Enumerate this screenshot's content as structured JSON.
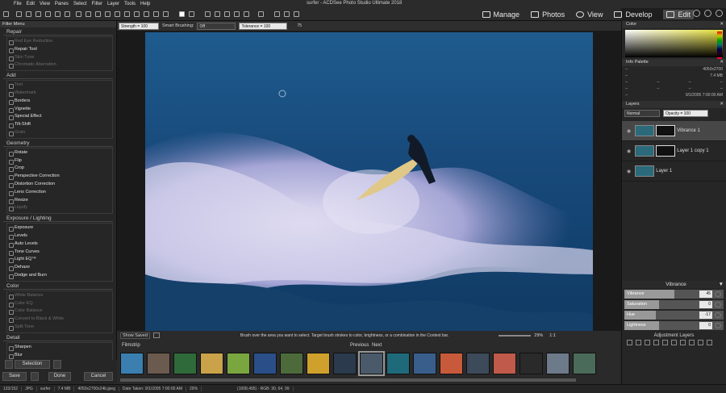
{
  "window": {
    "title": "surfer - ACDSee Photo Studio Ultimate 2018"
  },
  "menu": [
    "File",
    "Edit",
    "View",
    "Panes",
    "Select",
    "Filter",
    "Layer",
    "Tools",
    "Help"
  ],
  "modes": [
    {
      "label": "Manage"
    },
    {
      "label": "Photos"
    },
    {
      "label": "View"
    },
    {
      "label": "Develop"
    },
    {
      "label": "Edit"
    }
  ],
  "context_bar": {
    "strength": "Strength = 100",
    "smart_brushing_label": "Smart Brushing:",
    "smart_brushing_value": "Off",
    "tolerance": "Tolerance = 100",
    "brush_size": "75"
  },
  "filter_menu": {
    "title": "Filter Menu",
    "sections": [
      {
        "name": "Repair",
        "items": [
          {
            "label": "Red Eye Reduction",
            "dim": true
          },
          {
            "label": "Repair Tool",
            "dim": false
          },
          {
            "label": "Skin Tune",
            "dim": true
          },
          {
            "label": "Chromatic Aberration",
            "dim": true
          }
        ]
      },
      {
        "name": "Add",
        "items": [
          {
            "label": "Text",
            "dim": true
          },
          {
            "label": "Watermark",
            "dim": true
          },
          {
            "label": "Borders",
            "dim": false
          },
          {
            "label": "Vignette",
            "dim": false
          },
          {
            "label": "Special Effect",
            "dim": false
          },
          {
            "label": "Tilt-Shift",
            "dim": false
          },
          {
            "label": "Grain",
            "dim": true
          }
        ]
      },
      {
        "name": "Geometry",
        "items": [
          {
            "label": "Rotate",
            "dim": false
          },
          {
            "label": "Flip",
            "dim": false
          },
          {
            "label": "Crop",
            "dim": false
          },
          {
            "label": "Perspective Correction",
            "dim": false
          },
          {
            "label": "Distortion Correction",
            "dim": false
          },
          {
            "label": "Lens Correction",
            "dim": false
          },
          {
            "label": "Resize",
            "dim": false
          },
          {
            "label": "Liquify",
            "dim": true
          }
        ]
      },
      {
        "name": "Exposure / Lighting",
        "items": [
          {
            "label": "Exposure",
            "dim": false
          },
          {
            "label": "Levels",
            "dim": false
          },
          {
            "label": "Auto Levels",
            "dim": false
          },
          {
            "label": "Tone Curves",
            "dim": false
          },
          {
            "label": "Light EQ™",
            "dim": false
          },
          {
            "label": "Dehaze",
            "dim": false
          },
          {
            "label": "Dodge and Burn",
            "dim": false
          }
        ]
      },
      {
        "name": "Color",
        "items": [
          {
            "label": "White Balance",
            "dim": true
          },
          {
            "label": "Color EQ",
            "dim": true
          },
          {
            "label": "Color Balance",
            "dim": true
          },
          {
            "label": "Convert to Black & White",
            "dim": true
          },
          {
            "label": "Split Tone",
            "dim": true
          }
        ]
      },
      {
        "name": "Detail",
        "items": [
          {
            "label": "Sharpen",
            "dim": false
          },
          {
            "label": "Blur",
            "dim": false
          }
        ]
      }
    ]
  },
  "bottom_left": {
    "selection": "Selection",
    "save": "Save",
    "done": "Done",
    "cancel": "Cancel"
  },
  "image_status": {
    "show_saved": "Show Saved",
    "hint": "Brush over the area you want to select. Target brush strokes to color, brightness, or a combination in the Context bar.",
    "zoom": "29%",
    "ratio": "1:1"
  },
  "filmstrip": {
    "title": "Filmstrip",
    "previous": "Previous",
    "next": "Next"
  },
  "status": {
    "index": "133/152",
    "format": "JPG",
    "name": "surfer",
    "size": "7.4 MB",
    "dims": "4050x2700x24b.jpeg",
    "date": "Date Taken: 9/1/2005 7:00:00 AM",
    "zoom": "29%",
    "pixel": "(1008,495) - RGB: 30, 64, 99"
  },
  "color_panel": {
    "title": "Color"
  },
  "info_palette": {
    "title": "Info Palette",
    "dims": "4050x2700",
    "size": "7.4 MB",
    "date": "9/1/2005 7:00:00 AM",
    "dash": "--"
  },
  "layers": {
    "title": "Layers",
    "blend": "Normal",
    "opacity": "Opacity = 100",
    "items": [
      {
        "name": "Vibrance 1"
      },
      {
        "name": "Layer 1 copy 1"
      },
      {
        "name": "Layer 1"
      }
    ]
  },
  "vibrance": {
    "title": "Vibrance",
    "sliders": [
      {
        "label": "Vibrance",
        "value": "45",
        "frac": 0.72
      },
      {
        "label": "Saturation",
        "value": "0",
        "frac": 0.5
      },
      {
        "label": "Hue",
        "value": "-17",
        "frac": 0.45
      },
      {
        "label": "Lightness",
        "value": "0",
        "frac": 0.5
      }
    ]
  },
  "adjustment_layers": {
    "title": "Adjustment Layers"
  }
}
